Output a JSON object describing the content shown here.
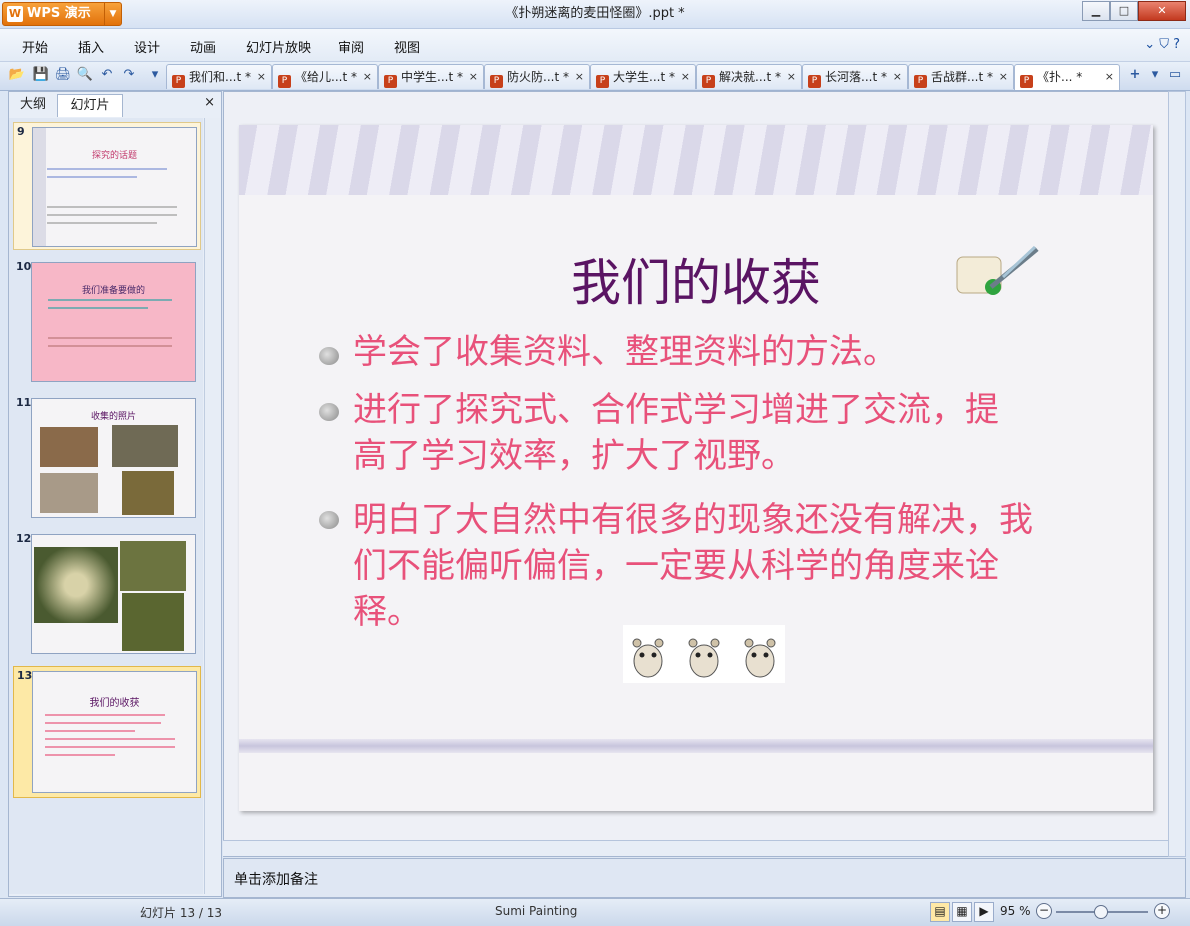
{
  "window": {
    "app_name": "WPS 演示",
    "app_logo": "W",
    "title": "《扑朔迷离的麦田怪圈》.ppt *",
    "minimize": "▁",
    "maximize": "□",
    "close": "✕"
  },
  "menu": {
    "items": [
      "开始",
      "插入",
      "设计",
      "动画",
      "幻灯片放映",
      "审阅",
      "视图"
    ],
    "right_icons": "⌄  ⛉  ?"
  },
  "toolbar": {
    "open": "📂",
    "save": "💾",
    "print": "🖨",
    "preview": "🔍",
    "undo": "↶",
    "redo": "↷",
    "more": "▾"
  },
  "doc_tabs": [
    {
      "label": "我们和...t *"
    },
    {
      "label": "《给儿...t *"
    },
    {
      "label": "中学生...t *"
    },
    {
      "label": "防火防...t *"
    },
    {
      "label": "大学生...t *"
    },
    {
      "label": "解决就...t *"
    },
    {
      "label": "长河落...t *"
    },
    {
      "label": "舌战群...t *"
    },
    {
      "label": "《扑... *"
    }
  ],
  "tab_close": "×",
  "tab_add": "+",
  "left_panel": {
    "tab_outline": "大纲",
    "tab_slides": "幻灯片",
    "close": "×",
    "thumbnails": [
      {
        "num": "9",
        "title": "探究的话题"
      },
      {
        "num": "10",
        "title": "我们准备要做的"
      },
      {
        "num": "11",
        "title": "收集的照片"
      },
      {
        "num": "12",
        "title": ""
      },
      {
        "num": "13",
        "title": "我们的收获"
      }
    ]
  },
  "slide": {
    "title": "我们的收获",
    "bullets": [
      "学会了收集资料、整理资料的方法。",
      "进行了探究式、合作式学习增进了交流，提高了学习效率，扩大了视野。",
      "明白了大自然中有很多的现象还没有解决，我们不能偏听偏信，一定要从科学的角度来诠释。"
    ]
  },
  "notes_placeholder": "单击添加备注",
  "status": {
    "slide_counter": "幻灯片 13 / 13",
    "theme": "Sumi Painting",
    "zoom": "95 %",
    "zoom_out": "−",
    "zoom_in": "+"
  },
  "colors": {
    "accent_orange": "#e2720b",
    "slide_title": "#5a1463",
    "bullet_text": "#e8517a"
  }
}
